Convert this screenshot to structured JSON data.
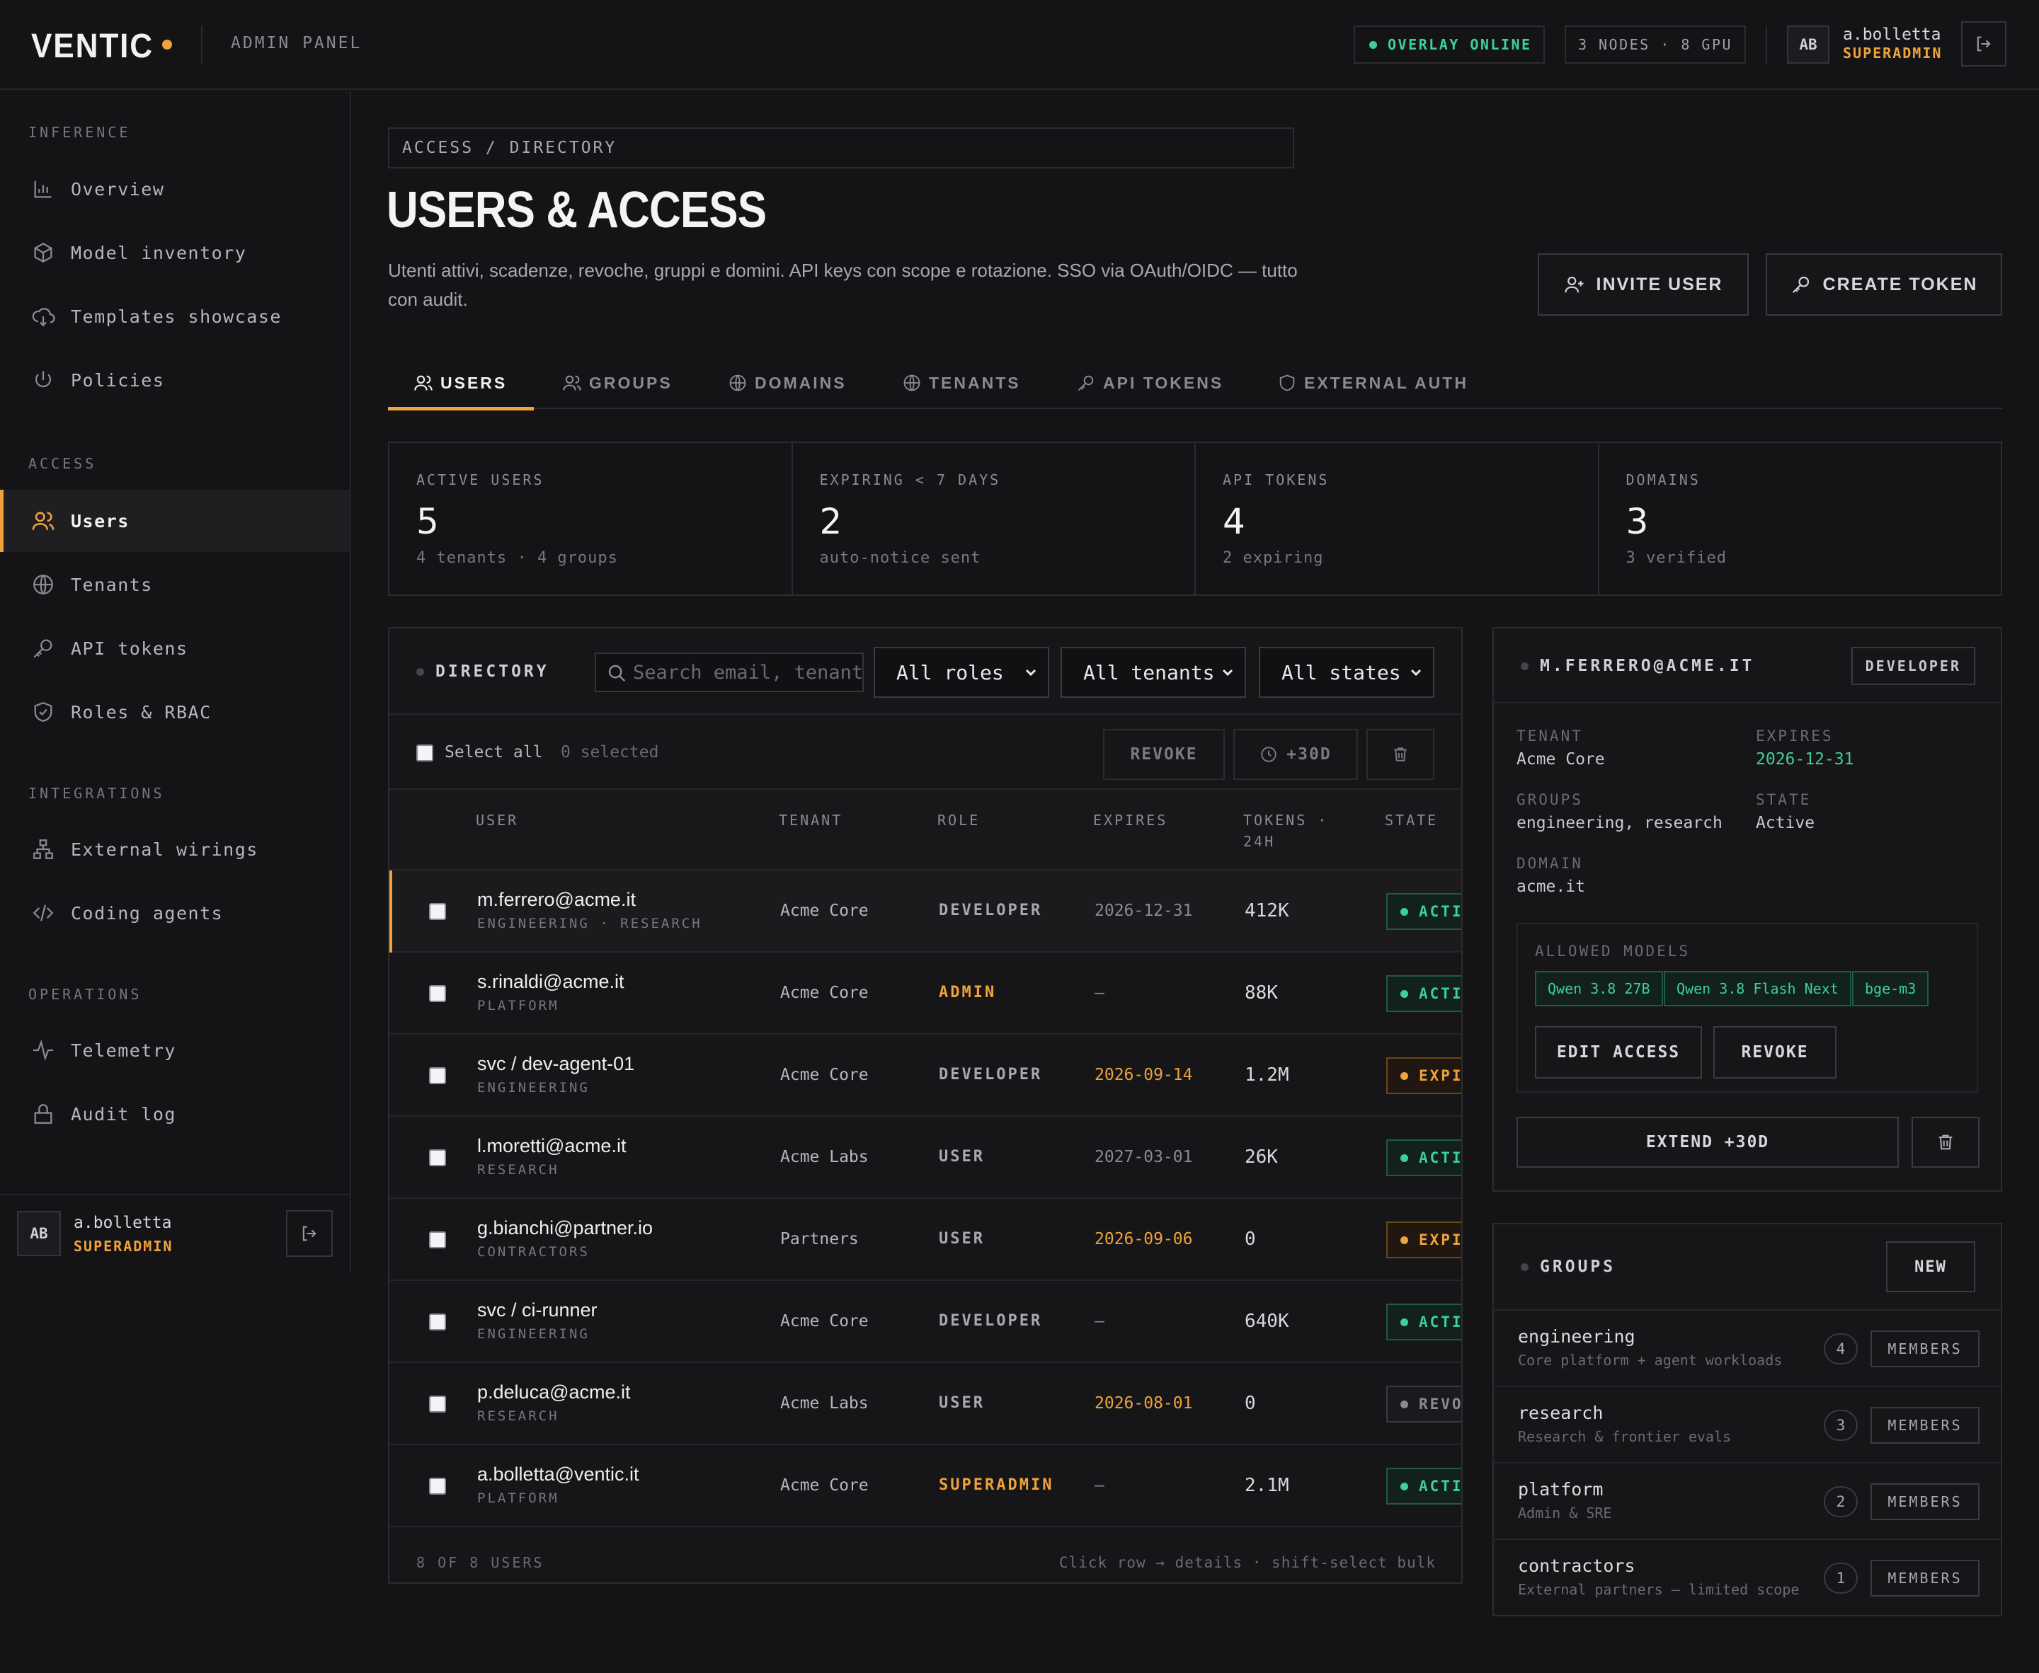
{
  "header": {
    "logo": "VENTIC",
    "panel_label": "ADMIN PANEL",
    "status": "OVERLAY ONLINE",
    "cluster": "3 NODES · 8 GPU",
    "user_initials": "AB",
    "user_name": "a.bolletta",
    "user_role": "SUPERADMIN",
    "colors": {
      "accent": "#f0a23b",
      "online": "#3ecf9a",
      "background": "#141416"
    }
  },
  "sidebar": {
    "sections": [
      {
        "title": "INFERENCE",
        "items": [
          {
            "label": "Overview",
            "icon": "bar-chart-icon"
          },
          {
            "label": "Model inventory",
            "icon": "cube-icon"
          },
          {
            "label": "Templates showcase",
            "icon": "cloud-download-icon"
          },
          {
            "label": "Policies",
            "icon": "power-icon"
          }
        ]
      },
      {
        "title": "ACCESS",
        "items": [
          {
            "label": "Users",
            "icon": "users-icon",
            "active": true
          },
          {
            "label": "Tenants",
            "icon": "globe-icon"
          },
          {
            "label": "API tokens",
            "icon": "key-icon"
          },
          {
            "label": "Roles & RBAC",
            "icon": "shield-check-icon"
          }
        ]
      },
      {
        "title": "INTEGRATIONS",
        "items": [
          {
            "label": "External wirings",
            "icon": "network-icon"
          },
          {
            "label": "Coding agents",
            "icon": "code-icon"
          }
        ]
      },
      {
        "title": "OPERATIONS",
        "items": [
          {
            "label": "Telemetry",
            "icon": "activity-icon"
          },
          {
            "label": "Audit log",
            "icon": "lock-icon"
          }
        ]
      }
    ],
    "footer": {
      "initials": "AB",
      "name": "a.bolletta",
      "role": "SUPERADMIN"
    }
  },
  "main": {
    "breadcrumb": "ACCESS / DIRECTORY",
    "title": "USERS & ACCESS",
    "description": "Utenti attivi, scadenze, revoche, gruppi e domini. API keys con scope e rotazione. SSO via OAuth/OIDC — tutto con audit.",
    "invite_label": "INVITE USER",
    "create_token_label": "CREATE TOKEN",
    "tabs": [
      {
        "label": "USERS",
        "icon": "users-icon",
        "active": true
      },
      {
        "label": "GROUPS",
        "icon": "users-icon"
      },
      {
        "label": "DOMAINS",
        "icon": "globe-icon"
      },
      {
        "label": "TENANTS",
        "icon": "globe-icon"
      },
      {
        "label": "API TOKENS",
        "icon": "key-icon"
      },
      {
        "label": "EXTERNAL AUTH",
        "icon": "shield-icon"
      }
    ],
    "stats": [
      {
        "label": "ACTIVE USERS",
        "value": "5",
        "sub": "4 tenants · 4 groups"
      },
      {
        "label": "EXPIRING < 7 DAYS",
        "value": "2",
        "sub": "auto-notice sent"
      },
      {
        "label": "API TOKENS",
        "value": "4",
        "sub": "2 expiring"
      },
      {
        "label": "DOMAINS",
        "value": "3",
        "sub": "3 verified"
      }
    ]
  },
  "directory": {
    "title": "DIRECTORY",
    "search_placeholder": "Search email, tenant",
    "filters": {
      "roles": "All roles",
      "tenants": "All tenants",
      "states": "All states"
    },
    "select_all": "Select all",
    "selected_count": "0 selected",
    "revoke_label": "REVOKE",
    "extend_label": "+30D",
    "columns": {
      "user": "USER",
      "tenant": "TENANT",
      "role": "ROLE",
      "expires": "EXPIRES",
      "tokens": "TOKENS ·",
      "tokens2": "24H",
      "state": "STATE"
    },
    "rows": [
      {
        "email": "m.ferrero@acme.it",
        "groups": "ENGINEERING · RESEARCH",
        "tenant": "Acme Core",
        "role": "DEVELOPER",
        "expires": "2026-12-31",
        "tokens": "412K",
        "state": "ACTIVE",
        "selected": true
      },
      {
        "email": "s.rinaldi@acme.it",
        "groups": "PLATFORM",
        "tenant": "Acme Core",
        "role": "ADMIN",
        "expires": "—",
        "tokens": "88K",
        "state": "ACTIVE"
      },
      {
        "email": "svc / dev-agent-01",
        "groups": "ENGINEERING",
        "tenant": "Acme Core",
        "role": "DEVELOPER",
        "expires": "2026-09-14",
        "tokens": "1.2M",
        "state": "EXPIRING"
      },
      {
        "email": "l.moretti@acme.it",
        "groups": "RESEARCH",
        "tenant": "Acme Labs",
        "role": "USER",
        "expires": "2027-03-01",
        "tokens": "26K",
        "state": "ACTIVE"
      },
      {
        "email": "g.bianchi@partner.io",
        "groups": "CONTRACTORS",
        "tenant": "Partners",
        "role": "USER",
        "expires": "2026-09-06",
        "tokens": "0",
        "state": "EXPIRING"
      },
      {
        "email": "svc / ci-runner",
        "groups": "ENGINEERING",
        "tenant": "Acme Core",
        "role": "DEVELOPER",
        "expires": "—",
        "tokens": "640K",
        "state": "ACTIVE"
      },
      {
        "email": "p.deluca@acme.it",
        "groups": "RESEARCH",
        "tenant": "Acme Labs",
        "role": "USER",
        "expires": "2026-08-01",
        "tokens": "0",
        "state": "REVOKED"
      },
      {
        "email": "a.bolletta@ventic.it",
        "groups": "PLATFORM",
        "tenant": "Acme Core",
        "role": "SUPERADMIN",
        "expires": "—",
        "tokens": "2.1M",
        "state": "ACTIVE"
      }
    ],
    "footer_count": "8 OF 8 USERS",
    "footer_hint": "Click row → details · shift-select bulk"
  },
  "detail": {
    "title": "M.FERRERO@ACME.IT",
    "badge": "DEVELOPER",
    "tenant_label": "TENANT",
    "tenant": "Acme Core",
    "expires_label": "EXPIRES",
    "expires": "2026-12-31",
    "groups_label": "GROUPS",
    "groups": "engineering, research",
    "state_label": "STATE",
    "state": "Active",
    "domain_label": "DOMAIN",
    "domain": "acme.it",
    "models_label": "ALLOWED MODELS",
    "models": [
      "Qwen 3.8 27B",
      "Qwen 3.8 Flash Next",
      "bge-m3"
    ],
    "edit_label": "EDIT ACCESS",
    "revoke_label": "REVOKE",
    "extend_label": "EXTEND +30D"
  },
  "groups": {
    "title": "GROUPS",
    "new_label": "NEW",
    "members_label": "MEMBERS",
    "items": [
      {
        "name": "engineering",
        "desc": "Core platform + agent workloads",
        "count": "4"
      },
      {
        "name": "research",
        "desc": "Research & frontier evals",
        "count": "3"
      },
      {
        "name": "platform",
        "desc": "Admin & SRE",
        "count": "2"
      },
      {
        "name": "contractors",
        "desc": "External partners — limited scope",
        "count": "1"
      }
    ]
  }
}
